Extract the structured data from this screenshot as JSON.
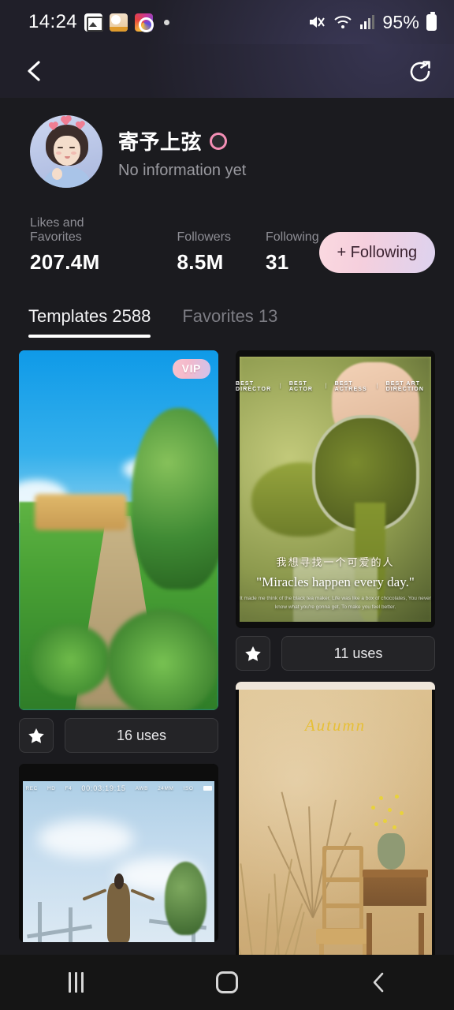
{
  "status_bar": {
    "time": "14:24",
    "battery_percent": "95%",
    "icons": [
      "photos-icon",
      "camera-icon",
      "instagram-icon",
      "notification-dot"
    ],
    "right_icons": [
      "mute-icon",
      "wifi-icon",
      "signal-icon",
      "battery-icon"
    ]
  },
  "top_nav": {
    "back_icon": "back-chevron-icon",
    "share_icon": "share-circle-icon"
  },
  "profile": {
    "name": "寄予上弦",
    "gender_icon": "female-gender-icon",
    "bio": "No information yet",
    "avatar_alt": "user-avatar"
  },
  "stats": [
    {
      "label": "Likes and Favorites",
      "value": "207.4M"
    },
    {
      "label": "Followers",
      "value": "8.5M"
    },
    {
      "label": "Following",
      "value": "31"
    }
  ],
  "follow_button": {
    "label": "+ Following",
    "gradient_start": "#fbd9e0",
    "gradient_end": "#ddd2ef",
    "text_color": "#3b2230"
  },
  "tabs": [
    {
      "label": "Templates 2588",
      "active": true
    },
    {
      "label": "Favorites 13",
      "active": false
    }
  ],
  "templates": {
    "left_column": [
      {
        "id": "garden-template",
        "badge": "VIP",
        "uses_label": "16 uses",
        "favorite_icon": "star-icon",
        "art": "blue sky with green tree and garden path"
      },
      {
        "id": "sky-camcorder-template",
        "timecode": "00:03:19:15",
        "art": "person with arms outstretched under blue sky, camcorder overlay"
      }
    ],
    "right_column": [
      {
        "id": "matcha-template",
        "awards": [
          "BEST DIRECTOR",
          "BEST ACTOR",
          "BEST ACTRESS",
          "BEST ART DIRECTION"
        ],
        "caption_cn": "我想寻找一个可爱的人",
        "caption_en": "\"Miracles happen every day.\"",
        "caption_sub": "It made me think of the black tea maker. Life was like a box of chocolates, You never know what you're gonna get. To make you feel better.",
        "uses_label": "11 uses",
        "favorite_icon": "star-icon",
        "art": "matcha being poured into a cup"
      },
      {
        "id": "autumn-template",
        "title": "Autumn",
        "art": "wooden chair and side table with dried grass against tan wall"
      }
    ]
  },
  "bottom_nav": [
    {
      "name": "recents-button",
      "icon": "recents-icon"
    },
    {
      "name": "home-button",
      "icon": "home-icon"
    },
    {
      "name": "back-button",
      "icon": "back-icon"
    }
  ],
  "colors": {
    "background": "#1b1b1f",
    "header_bg": "#201f29",
    "accent_pink": "#f5cfdd",
    "accent_purple": "#ddd2ef",
    "text_primary": "#ffffff",
    "text_secondary": "#8e8e95"
  }
}
